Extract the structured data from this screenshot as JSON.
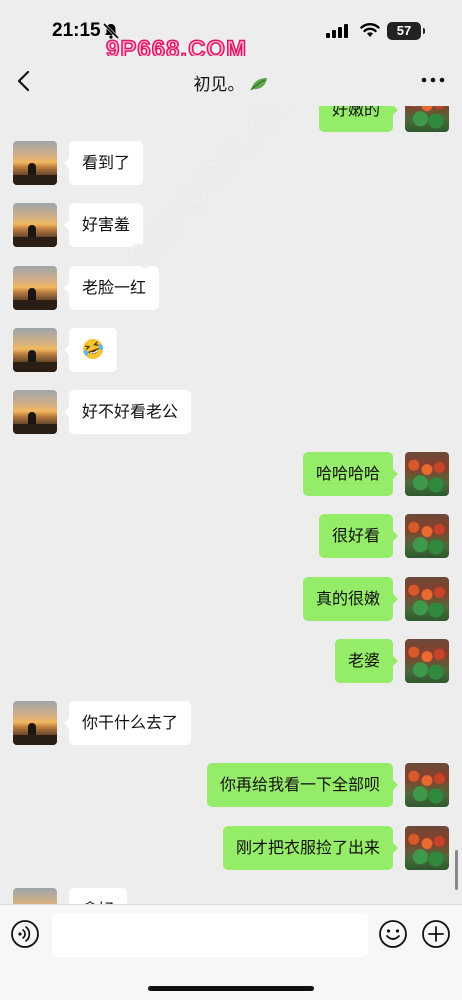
{
  "status_bar": {
    "time": "21:15",
    "watermark": "9P668.COM",
    "battery": "57"
  },
  "nav": {
    "title": "初见。"
  },
  "watermark_diagonal": "91PORN.COM",
  "colors": {
    "background": "#ededed",
    "sent_bubble": "#95ec69",
    "received_bubble": "#ffffff"
  },
  "messages": [
    {
      "side": "right",
      "text": "好嫩的"
    },
    {
      "side": "left",
      "text": "看到了"
    },
    {
      "side": "left",
      "text": "好害羞"
    },
    {
      "side": "left",
      "text": "老脸一红"
    },
    {
      "side": "left",
      "icon": "laughing-tears-emoji"
    },
    {
      "side": "left",
      "text": "好不好看老公"
    },
    {
      "side": "right",
      "text": "哈哈哈哈"
    },
    {
      "side": "right",
      "text": "很好看"
    },
    {
      "side": "right",
      "text": "真的很嫩"
    },
    {
      "side": "right",
      "text": "老婆"
    },
    {
      "side": "left",
      "text": "你干什么去了"
    },
    {
      "side": "right",
      "text": "你再给我看一下全部呗"
    },
    {
      "side": "right",
      "text": "刚才把衣服捡了出来"
    },
    {
      "side": "left",
      "text": "拿好"
    }
  ],
  "input": {
    "value": ""
  },
  "icons": {
    "back": "chevron-left-icon",
    "more": "more-dots-icon",
    "voice": "voice-icon",
    "emoji": "smiley-icon",
    "plus": "plus-icon",
    "silent": "bell-slash-icon",
    "signal": "cellular-signal-icon",
    "wifi": "wifi-icon",
    "title_decoration": "leaf-icon"
  }
}
